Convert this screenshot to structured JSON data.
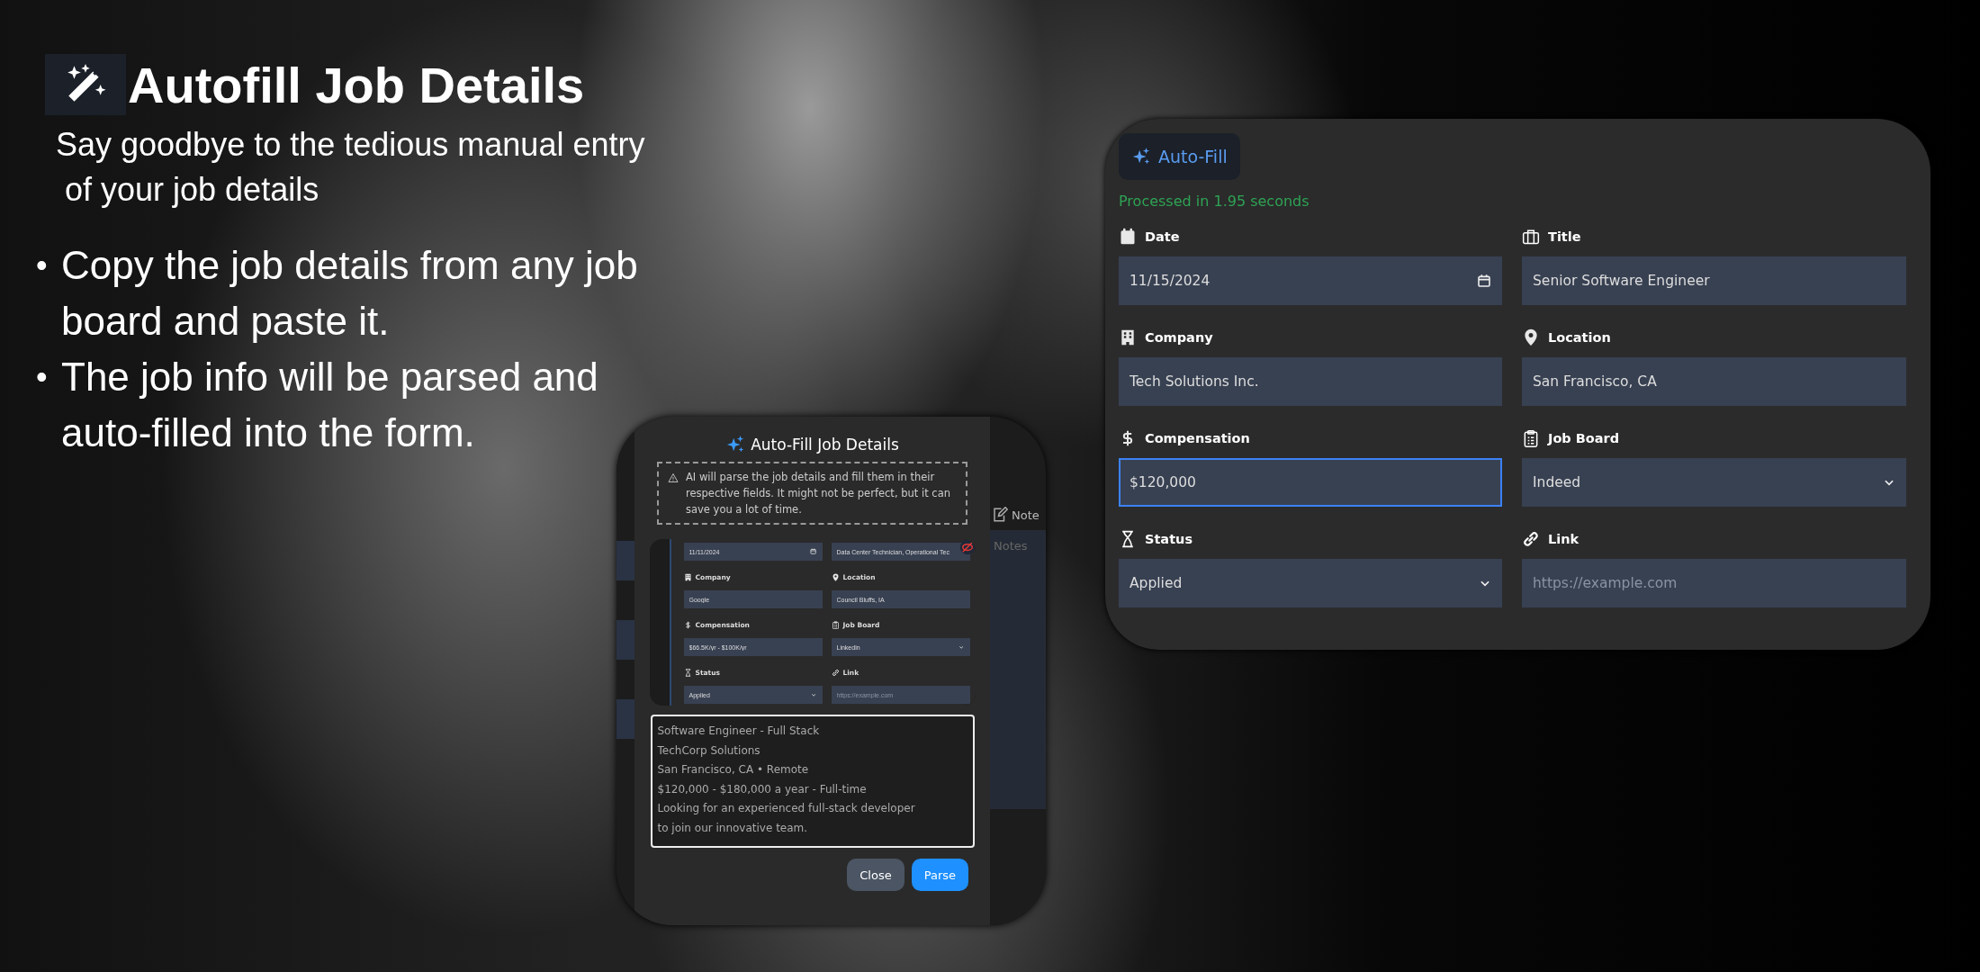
{
  "hero": {
    "title": "Autofill Job Details",
    "subtitle": [
      "Say goodbye to the tedious manual entry",
      "of your job details"
    ],
    "bullets": [
      {
        "marker": "•",
        "text": "Copy the job details from any job board and paste it."
      },
      {
        "marker": "•",
        "text": "The job info will be parsed and auto-filled into the form."
      }
    ]
  },
  "dialog": {
    "title": "Auto-Fill Job Details",
    "notice": "AI will parse the job details and fill them in their respective fields. It might not be perfect, but it can save you a lot of time.",
    "background": {
      "notes_heading": "Note",
      "notes_placeholder": "Notes"
    },
    "fields": [
      {
        "kind": "date",
        "value": "11/11/2024"
      },
      {
        "kind": "text",
        "value": "Data Center Technician, Operational Tec"
      },
      {
        "label": "Company",
        "kind": "text",
        "value": "Google"
      },
      {
        "label": "Location",
        "kind": "text",
        "value": "Council Bluffs, IA"
      },
      {
        "label": "Compensation",
        "kind": "text",
        "value": "$66.5K/yr - $100K/yr"
      },
      {
        "label": "Job Board",
        "kind": "select",
        "value": "Linkedin"
      },
      {
        "label": "Status",
        "kind": "select",
        "value": "Applied"
      },
      {
        "label": "Link",
        "kind": "text",
        "placeholder": "https://example.com"
      }
    ],
    "textarea": {
      "value": "Software Engineer - Full Stack\nTechCorp Solutions\nSan Francisco, CA • Remote\n$120,000 - $180,000 a year - Full-time\nLooking for an experienced full-stack developer\nto join our innovative team."
    },
    "buttons": [
      {
        "label": "Close",
        "kind": "secondary"
      },
      {
        "label": "Parse",
        "kind": "primary"
      }
    ]
  },
  "panel": {
    "autofill_button": "Auto-Fill",
    "status": "Processed in 1.95 seconds",
    "fields": [
      {
        "label": "Date",
        "kind": "date",
        "value": "11/15/2024",
        "focused": false
      },
      {
        "label": "Title",
        "kind": "text",
        "value": "Senior Software Engineer",
        "focused": false
      },
      {
        "label": "Company",
        "kind": "text",
        "value": "Tech Solutions Inc.",
        "focused": false
      },
      {
        "label": "Location",
        "kind": "text",
        "value": "San Francisco, CA",
        "focused": false
      },
      {
        "label": "Compensation",
        "kind": "text",
        "value": "$120,000",
        "focused": true
      },
      {
        "label": "Job Board",
        "kind": "select",
        "value": "Indeed",
        "focused": false
      },
      {
        "label": "Status",
        "kind": "select",
        "value": "Applied",
        "focused": false
      },
      {
        "label": "Link",
        "kind": "text",
        "placeholder": "https://example.com",
        "focused": false
      }
    ]
  }
}
